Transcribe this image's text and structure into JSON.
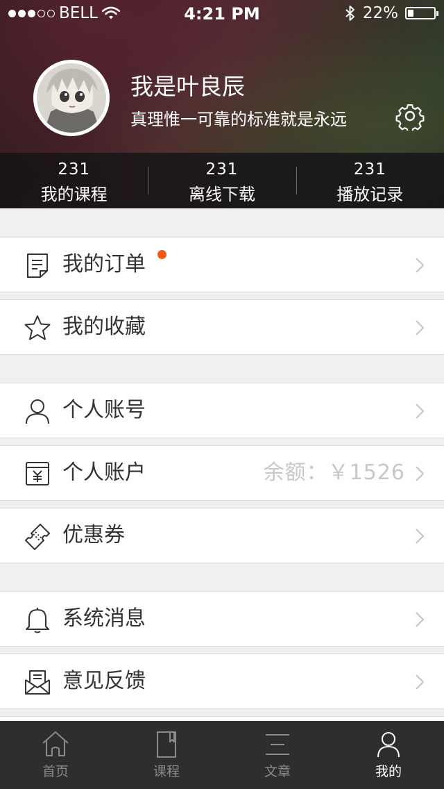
{
  "status_bar": {
    "carrier": "BELL",
    "time": "4:21 PM",
    "battery": "22%",
    "battery_level": 0.22,
    "signal_bars": 3,
    "signal_total": 5
  },
  "profile": {
    "name": "我是叶良辰",
    "motto": "真理惟一可靠的标准就是永远"
  },
  "stats": [
    {
      "count": "231",
      "label": "我的课程"
    },
    {
      "count": "231",
      "label": "离线下载"
    },
    {
      "count": "231",
      "label": "播放记录"
    }
  ],
  "menu": {
    "orders": {
      "label": "我的订单",
      "icon": "order-icon",
      "has_badge": true
    },
    "favorites": {
      "label": "我的收藏",
      "icon": "star-icon"
    },
    "account": {
      "label": "个人账号",
      "icon": "user-icon"
    },
    "wallet": {
      "label": "个人账户",
      "icon": "wallet-icon",
      "value": "余额：￥1526"
    },
    "coupons": {
      "label": "优惠券",
      "icon": "coupon-icon"
    },
    "messages": {
      "label": "系统消息",
      "icon": "bell-icon"
    },
    "feedback": {
      "label": "意见反馈",
      "icon": "envelope-icon"
    }
  },
  "tabs": [
    {
      "label": "首页",
      "icon": "home-icon",
      "active": false
    },
    {
      "label": "课程",
      "icon": "book-icon",
      "active": false
    },
    {
      "label": "文章",
      "icon": "article-icon",
      "active": false
    },
    {
      "label": "我的",
      "icon": "profile-icon",
      "active": true
    }
  ],
  "colors": {
    "badge": "#f05a14",
    "tab_active": "#ffffff",
    "tab_inactive": "#8a8a8a",
    "tabbar_bg": "#2e2e2e",
    "value_text": "#c8c8c8"
  }
}
